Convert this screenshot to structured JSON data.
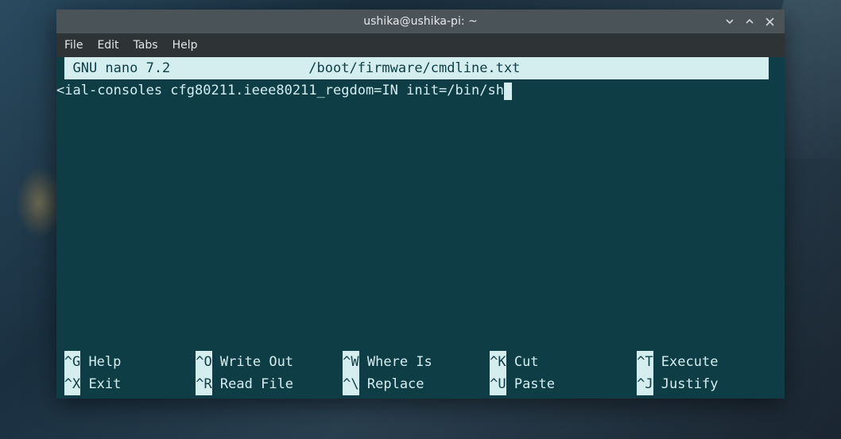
{
  "titlebar": {
    "title": "ushika@ushika-pi: ~"
  },
  "menubar": {
    "items": [
      "File",
      "Edit",
      "Tabs",
      "Help"
    ]
  },
  "nano": {
    "app_name": "GNU nano 7.2",
    "file_path": "/boot/firmware/cmdline.txt",
    "content_prefix": "<",
    "content_line": "ial-consoles cfg80211.ieee80211_regdom=IN init=/bin/sh"
  },
  "shortcuts": {
    "row1": [
      {
        "key": "^G",
        "label": "Help"
      },
      {
        "key": "^O",
        "label": "Write Out"
      },
      {
        "key": "^W",
        "label": "Where Is"
      },
      {
        "key": "^K",
        "label": "Cut"
      },
      {
        "key": "^T",
        "label": "Execute"
      }
    ],
    "row2": [
      {
        "key": "^X",
        "label": "Exit"
      },
      {
        "key": "^R",
        "label": "Read File"
      },
      {
        "key": "^\\",
        "label": "Replace"
      },
      {
        "key": "^U",
        "label": "Paste"
      },
      {
        "key": "^J",
        "label": "Justify"
      }
    ]
  }
}
